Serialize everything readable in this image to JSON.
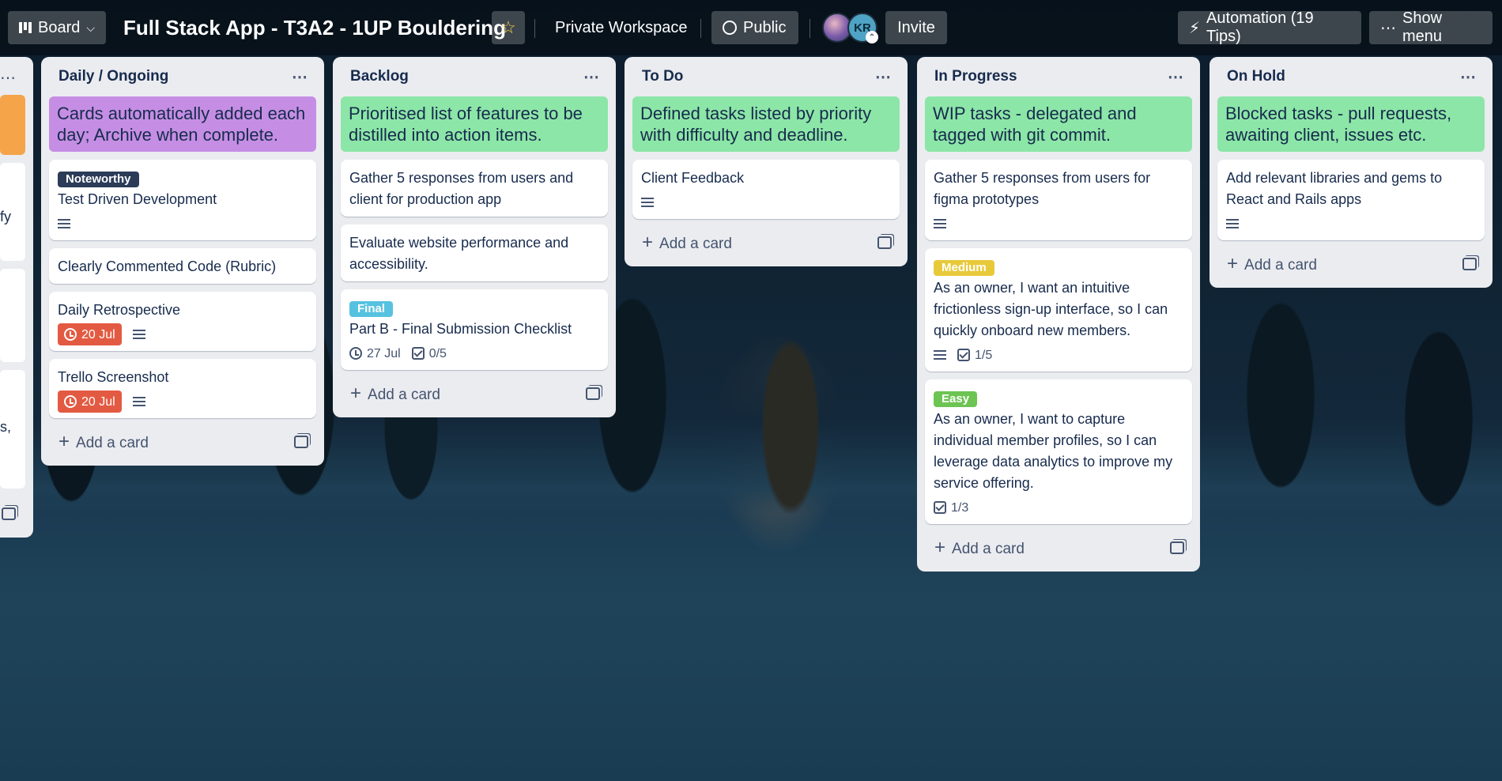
{
  "topbar": {
    "view_label": "Board",
    "board_title": "Full Stack App - T3A2 - 1UP Bouldering",
    "workspace": "Private Workspace",
    "visibility": "Public",
    "avatar_initials": "KR",
    "invite": "Invite",
    "automation": "Automation (19 Tips)",
    "show_menu": "Show menu"
  },
  "partial_list": {
    "fragment_1": "fy",
    "fragment_2": "s,"
  },
  "lists": [
    {
      "title": "Daily / Ongoing",
      "cover": "Cards automatically added each day; Archive when complete.",
      "cover_color": "#c58ee4",
      "cards": [
        {
          "label": "Noteworthy",
          "title": "Test Driven Development"
        },
        {
          "title": "Clearly Commented Code (Rubric)"
        },
        {
          "title": "Daily Retrospective",
          "due": "20 Jul"
        },
        {
          "title": "Trello Screenshot",
          "due": "20 Jul"
        }
      ],
      "add_card": "Add a card"
    },
    {
      "title": "Backlog",
      "cover": "Prioritised list of features to be distilled into action items.",
      "cover_color": "#8ce6a7",
      "cards": [
        {
          "title": "Gather 5 responses from users and client for production app"
        },
        {
          "title": "Evaluate website performance and accessibility."
        },
        {
          "label": "Final",
          "title": "Part B - Final Submission Checklist",
          "date": "27 Jul",
          "checklist": "0/5"
        }
      ],
      "add_card": "Add a card"
    },
    {
      "title": "To Do",
      "cover": "Defined tasks listed by priority with difficulty and deadline.",
      "cover_color": "#8ce6a7",
      "cards": [
        {
          "title": "Client Feedback"
        }
      ],
      "add_card": "Add a card"
    },
    {
      "title": "In Progress",
      "cover": "WIP tasks - delegated and tagged with git commit.",
      "cover_color": "#8ce6a7",
      "cards": [
        {
          "title": "Gather 5 responses from users for figma prototypes"
        },
        {
          "label": "Medium",
          "title": "As an owner, I want an intuitive frictionless sign-up interface, so I can quickly onboard new members.",
          "checklist": "1/5"
        },
        {
          "label": "Easy",
          "title": "As an owner, I want to capture individual member profiles, so I can leverage data analytics to improve my service offering.",
          "checklist": "1/3"
        }
      ],
      "add_card": "Add a card"
    },
    {
      "title": "On Hold",
      "cover": "Blocked tasks - pull requests, awaiting client, issues etc.",
      "cover_color": "#8ce6a7",
      "cards": [
        {
          "title": "Add relevant libraries and gems to React and Rails apps"
        }
      ],
      "add_card": "Add a card"
    }
  ],
  "colors": {
    "label_noteworthy": "#2b3b58",
    "label_final": "#56c2e0",
    "label_medium": "#e8c93a",
    "label_easy": "#6cc452",
    "due_badge": "#e35a42"
  },
  "icons": {
    "board_view": "board-icon",
    "star": "star-icon",
    "public": "globe-icon",
    "automation": "lightning-icon",
    "menu": "ellipsis-icon",
    "description": "description-icon",
    "checklist": "checklist-icon",
    "due": "clock-icon",
    "template": "template-icon"
  }
}
